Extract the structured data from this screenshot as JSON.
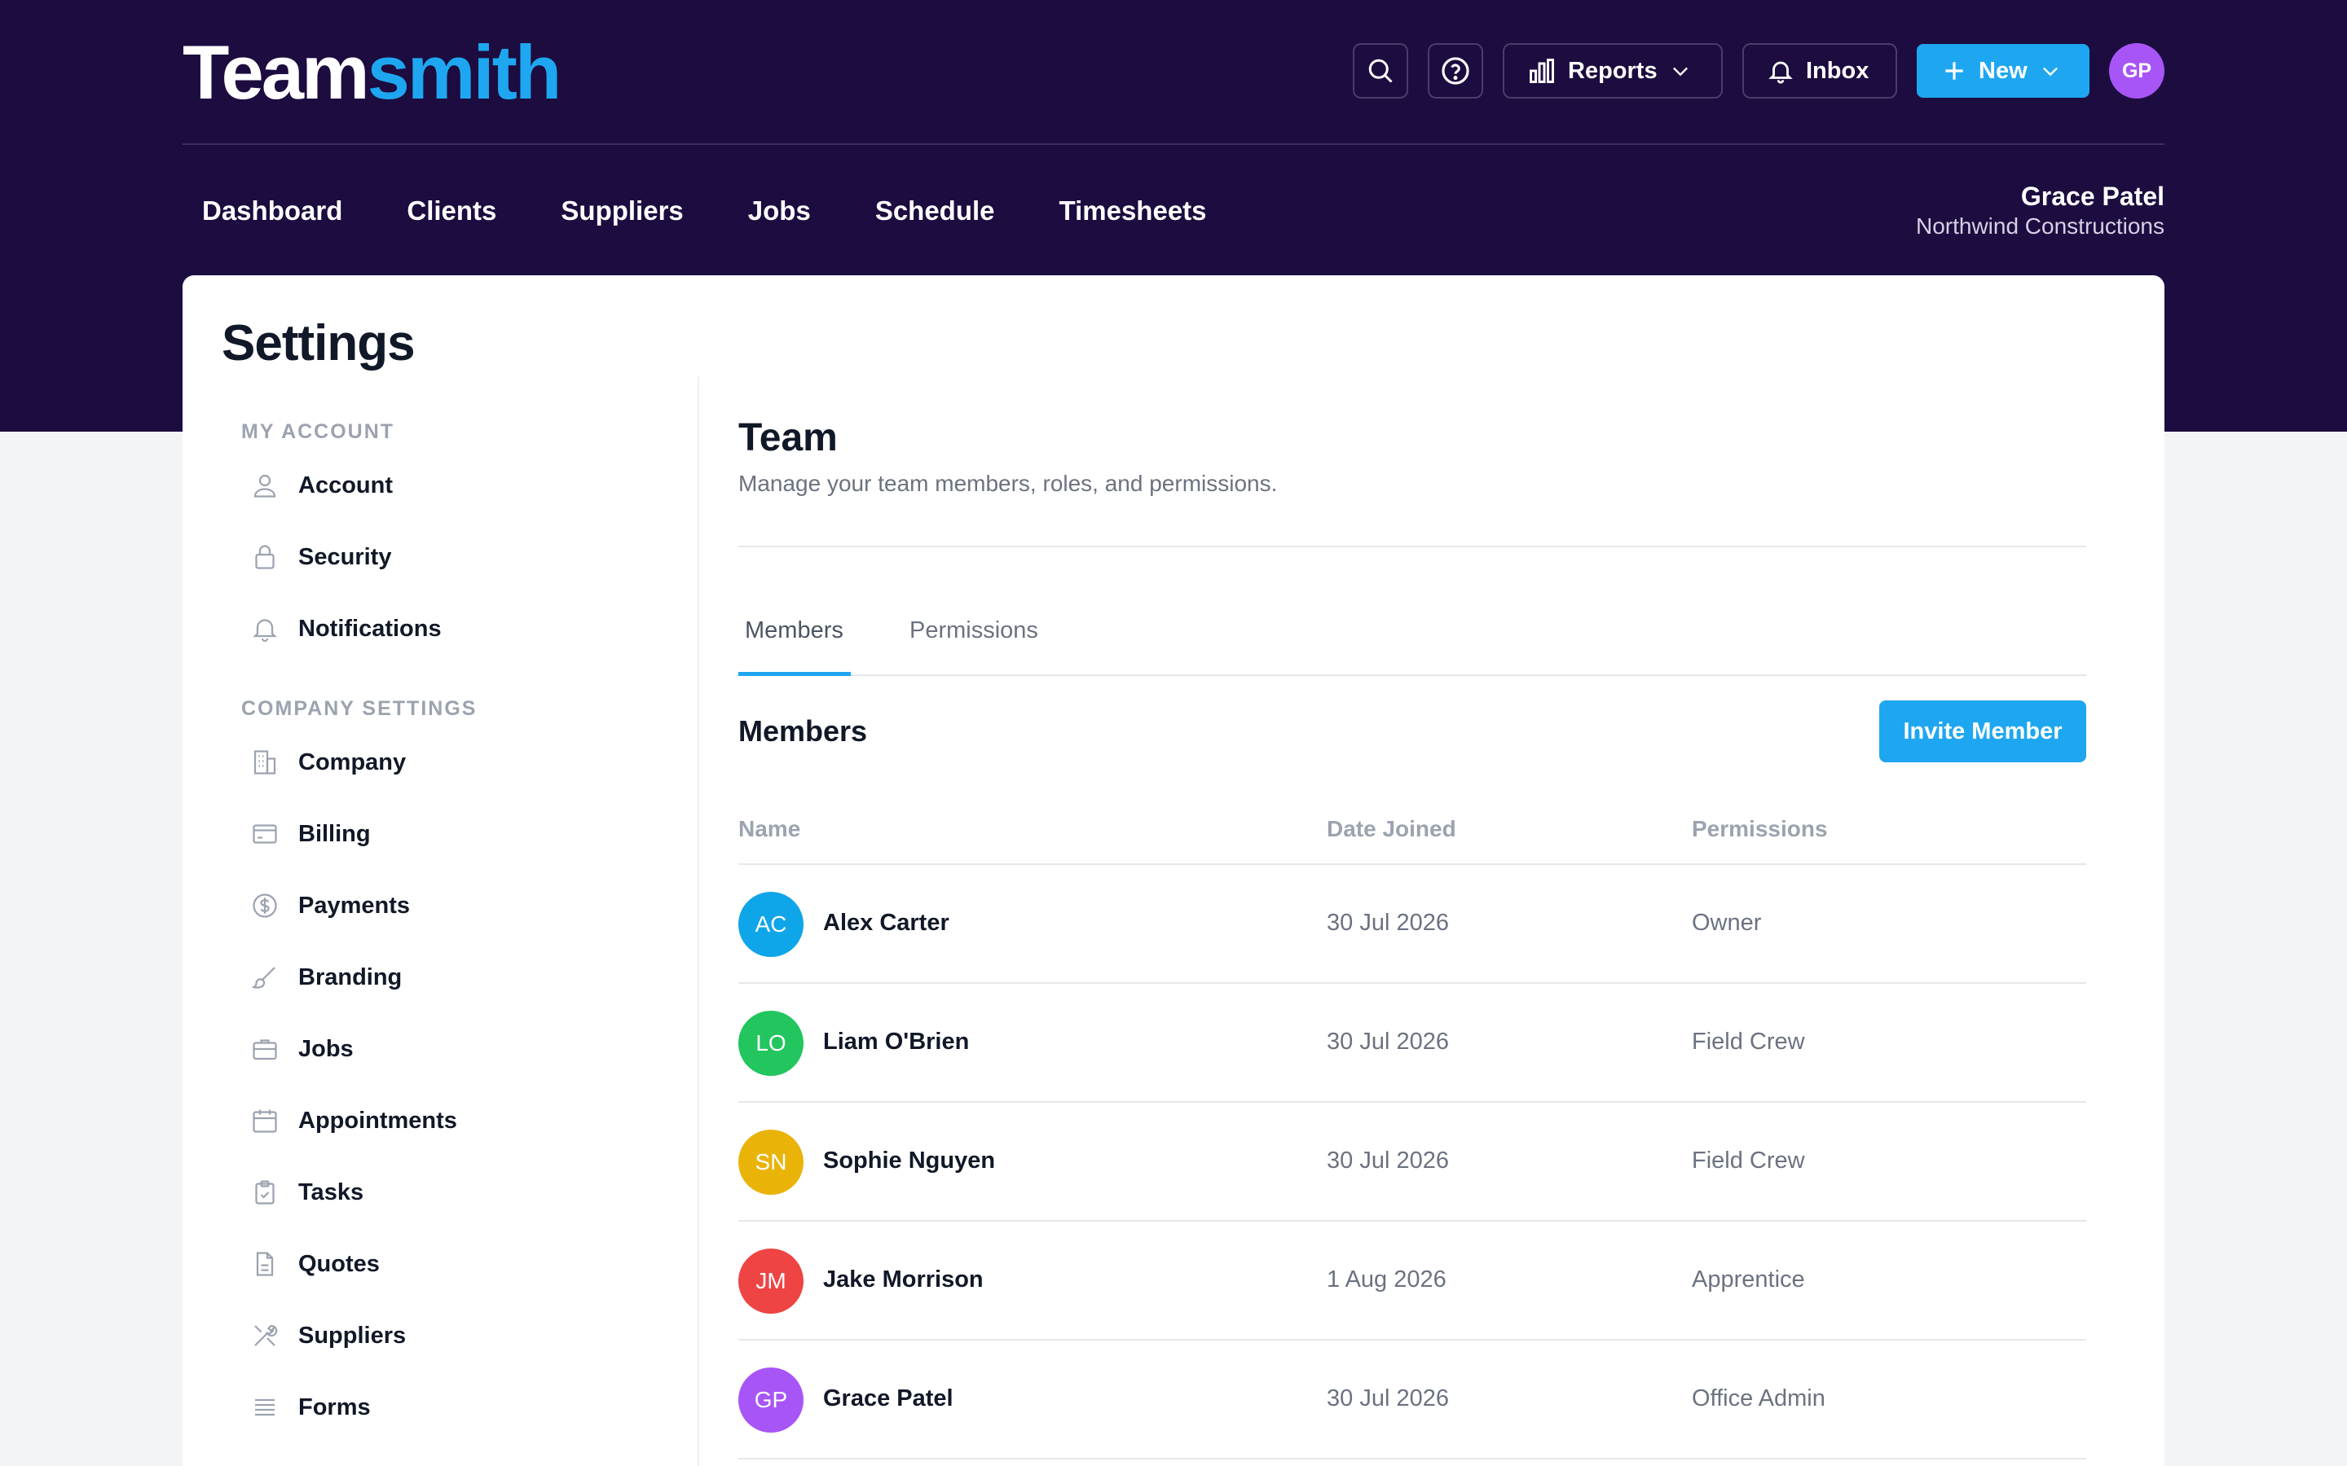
{
  "app": {
    "logo_part1": "Team",
    "logo_part2": "smith"
  },
  "header": {
    "reports_label": "Reports",
    "inbox_label": "Inbox",
    "new_label": "New",
    "avatar_initials": "GP",
    "icons": [
      "search-icon",
      "help-icon",
      "bar-chart-icon",
      "chevron-down-icon",
      "bell-icon",
      "plus-icon"
    ]
  },
  "nav": {
    "items": [
      {
        "label": "Dashboard"
      },
      {
        "label": "Clients"
      },
      {
        "label": "Suppliers"
      },
      {
        "label": "Jobs"
      },
      {
        "label": "Schedule"
      },
      {
        "label": "Timesheets"
      }
    ]
  },
  "user": {
    "name": "Grace Patel",
    "company": "Northwind Constructions"
  },
  "page": {
    "title": "Settings"
  },
  "sidebar": {
    "sections": [
      {
        "heading": "MY ACCOUNT",
        "items": [
          {
            "label": "Account",
            "icon": "user-icon"
          },
          {
            "label": "Security",
            "icon": "lock-icon"
          },
          {
            "label": "Notifications",
            "icon": "bell-icon"
          }
        ]
      },
      {
        "heading": "COMPANY SETTINGS",
        "items": [
          {
            "label": "Company",
            "icon": "building-icon"
          },
          {
            "label": "Billing",
            "icon": "credit-card-icon"
          },
          {
            "label": "Payments",
            "icon": "dollar-circle-icon"
          },
          {
            "label": "Branding",
            "icon": "brush-icon"
          },
          {
            "label": "Jobs",
            "icon": "briefcase-icon"
          },
          {
            "label": "Appointments",
            "icon": "calendar-icon"
          },
          {
            "label": "Tasks",
            "icon": "clipboard-check-icon"
          },
          {
            "label": "Quotes",
            "icon": "document-icon"
          },
          {
            "label": "Suppliers",
            "icon": "tools-icon"
          },
          {
            "label": "Forms",
            "icon": "list-icon"
          }
        ]
      }
    ]
  },
  "team": {
    "title": "Team",
    "subtitle": "Manage your team members, roles, and permissions.",
    "tabs": [
      {
        "label": "Members",
        "active": true
      },
      {
        "label": "Permissions",
        "active": false
      }
    ],
    "members_heading": "Members",
    "invite_label": "Invite Member",
    "columns": [
      "Name",
      "Date Joined",
      "Permissions"
    ],
    "rows": [
      {
        "initials": "AC",
        "name": "Alex Carter",
        "date": "30 Jul 2026",
        "permission": "Owner",
        "color": "#0ea5e9"
      },
      {
        "initials": "LO",
        "name": "Liam O'Brien",
        "date": "30 Jul 2026",
        "permission": "Field Crew",
        "color": "#22c55e"
      },
      {
        "initials": "SN",
        "name": "Sophie Nguyen",
        "date": "30 Jul 2026",
        "permission": "Field Crew",
        "color": "#eab308"
      },
      {
        "initials": "JM",
        "name": "Jake Morrison",
        "date": "1 Aug 2026",
        "permission": "Apprentice",
        "color": "#ef4444"
      },
      {
        "initials": "GP",
        "name": "Grace Patel",
        "date": "30 Jul 2026",
        "permission": "Office Admin",
        "color": "#a855f7"
      }
    ]
  },
  "colors": {
    "header_bg": "#1c0c3f",
    "accent": "#1ea7f0",
    "page_bg": "#f3f4f6"
  }
}
